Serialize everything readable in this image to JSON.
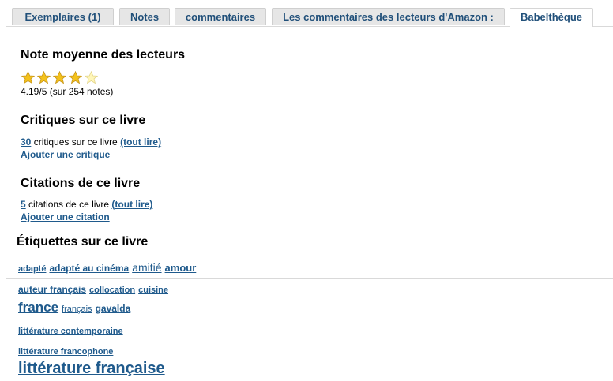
{
  "tabs": [
    {
      "label": "Exemplaires (1)",
      "active": false
    },
    {
      "label": "Notes",
      "active": false
    },
    {
      "label": "commentaires",
      "active": false
    },
    {
      "label": "Les commentaires des lecteurs d'Amazon :",
      "active": false
    },
    {
      "label": "Babelthèque",
      "active": true
    }
  ],
  "rating": {
    "title": "Note moyenne des lecteurs",
    "stars_filled": 4,
    "stars_total": 5,
    "summary": "4.19/5 (sur 254 notes)",
    "colors": {
      "filled": "#f4c21b",
      "empty": "#fff6b8"
    }
  },
  "reviews": {
    "title": "Critiques sur ce livre",
    "count": "30",
    "text": "critiques sur ce livre",
    "read_all": "(tout lire)",
    "add": "Ajouter une critique"
  },
  "quotes": {
    "title": "Citations de ce livre",
    "count": "5",
    "text": "citations de ce livre",
    "read_all": "(tout lire)",
    "add": "Ajouter une citation"
  },
  "tags": {
    "title": "Étiquettes sur ce livre",
    "items": [
      "adapté",
      "adapté au cinéma",
      "amitié",
      "amour",
      "auteur français",
      "collocation",
      "cuisine",
      "france",
      "français",
      "gavalda",
      "littérature contemporaine",
      "littérature francophone",
      "littérature française"
    ]
  },
  "link_color": "#1f5a8c"
}
